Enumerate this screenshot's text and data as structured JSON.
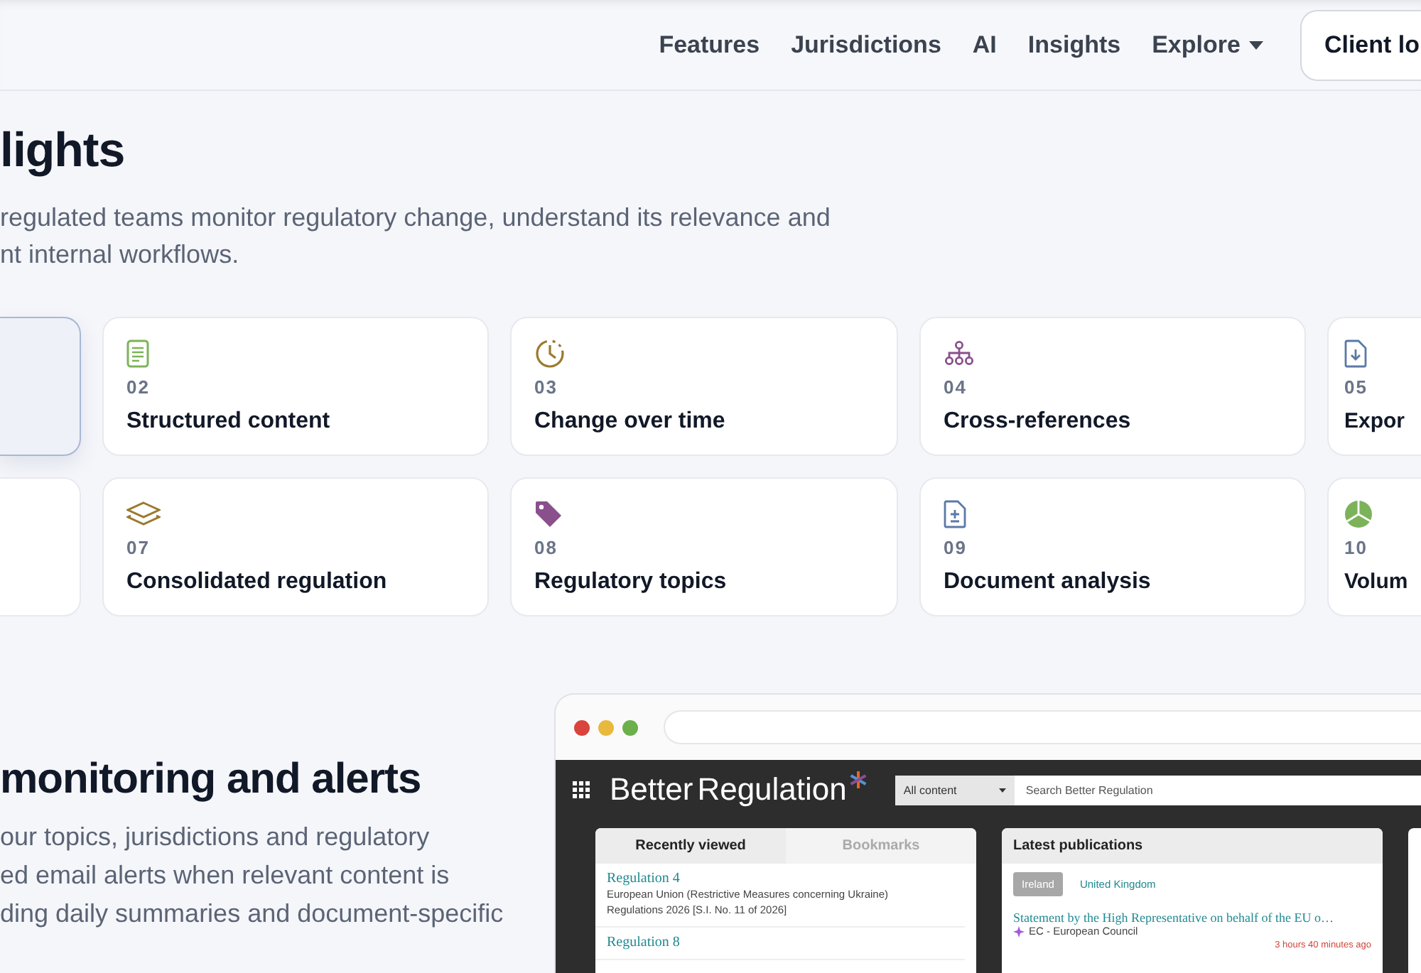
{
  "nav": {
    "links": [
      {
        "label": "Features",
        "dropdown": false
      },
      {
        "label": "Jurisdictions",
        "dropdown": false
      },
      {
        "label": "AI",
        "dropdown": false
      },
      {
        "label": "Insights",
        "dropdown": false
      },
      {
        "label": "Explore",
        "dropdown": true
      }
    ],
    "button": "Client lo"
  },
  "intro": {
    "heading": "lights",
    "text": [
      "regulated teams monitor regulatory change, understand its relevance and",
      "nt internal workflows."
    ]
  },
  "cards": [
    [
      {
        "selected": true
      },
      {
        "number": "02",
        "title": "Structured content",
        "selected": false
      },
      {
        "number": "03",
        "title": "Change over time",
        "selected": false
      },
      {
        "number": "04",
        "title": "Cross-references",
        "selected": false
      },
      {
        "number": "05",
        "title": "Expor",
        "selected": false
      }
    ],
    [
      {
        "selected": false
      },
      {
        "number": "07",
        "title": "Consolidated regulation",
        "selected": false
      },
      {
        "number": "08",
        "title": "Regulatory topics",
        "selected": false
      },
      {
        "number": "09",
        "title": "Document analysis",
        "selected": false
      },
      {
        "number": "10",
        "title": "Volum",
        "selected": false
      }
    ]
  ],
  "monitoring": {
    "heading": "monitoring and alerts",
    "text": [
      "our topics, jurisdictions and regulatory",
      "ed email alerts when relevant content is",
      "ding daily summaries and document-specific"
    ]
  },
  "mockup": {
    "logo": [
      "Better",
      "Regulation"
    ],
    "scope": "All content",
    "search_placeholder": "Search Better Regulation",
    "recent": {
      "tabs": [
        {
          "label": "Recently viewed",
          "selected": true
        },
        {
          "label": "Bookmarks",
          "selected": false
        }
      ],
      "items": [
        {
          "title": "Regulation 4",
          "text": "European Union (Restrictive Measures concerning Ukraine) Regulations 2026 [S.I. No. 11 of 2026]"
        },
        {
          "title": "Regulation 8"
        }
      ]
    },
    "latest": {
      "title": "Latest publications",
      "tabs": [
        {
          "label": "Ireland",
          "selected": true
        },
        {
          "label": "United Kingdom",
          "selected": false
        }
      ],
      "items": [
        {
          "title": "Statement by the High Representative on behalf of the EU o…",
          "source": "EC - European Council",
          "time": "3 hours 40 minutes ago"
        }
      ]
    }
  }
}
